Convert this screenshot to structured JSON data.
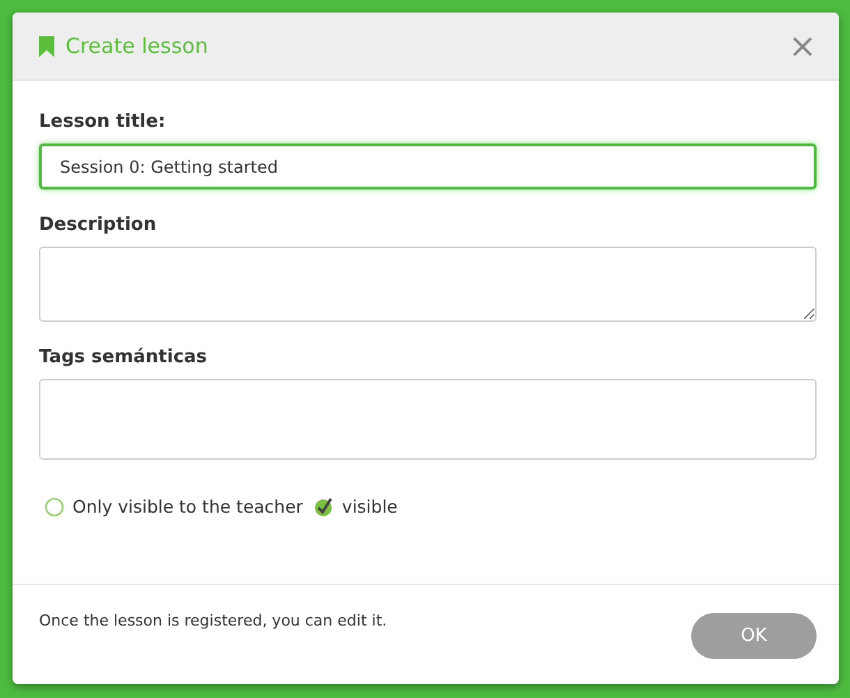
{
  "dialog": {
    "title": "Create lesson",
    "close": "×"
  },
  "fields": [
    {
      "label": "Lesson title:",
      "kind": "input",
      "value": "Session 0: Getting started",
      "focused": true
    },
    {
      "label": "Description",
      "kind": "textarea",
      "focused": false
    },
    {
      "label": "Tags semánticas",
      "kind": "textarea-plain",
      "focused": false
    }
  ],
  "visibility": [
    {
      "label": "Only visible to the teacher",
      "selected": false
    },
    {
      "label": "visible",
      "selected": true
    }
  ],
  "footer": {
    "note": "Once the lesson is registered, you can edit it.",
    "button": "OK"
  }
}
